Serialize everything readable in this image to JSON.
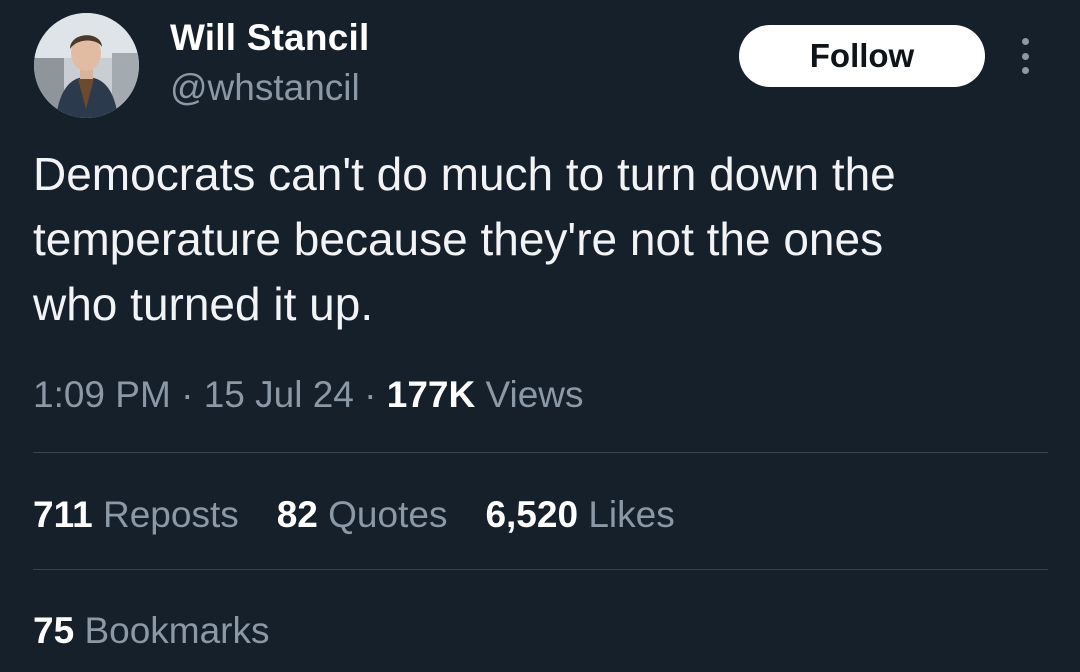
{
  "author": {
    "display_name": "Will Stancil",
    "handle": "@whstancil",
    "avatar_icon": "profile-photo"
  },
  "header": {
    "follow_label": "Follow",
    "more_icon": "more-vertical-icon"
  },
  "tweet": {
    "lines": [
      "Democrats can't do much to turn down the",
      "temperature because they're not the ones",
      "who turned it up."
    ]
  },
  "meta": {
    "time": "1:09 PM",
    "separator": "·",
    "date": "15 Jul 24",
    "views_count": "177K",
    "views_label": "Views"
  },
  "stats": {
    "reposts_count": "711",
    "reposts_label": "Reposts",
    "quotes_count": "82",
    "quotes_label": "Quotes",
    "likes_count": "6,520",
    "likes_label": "Likes",
    "bookmarks_count": "75",
    "bookmarks_label": "Bookmarks"
  },
  "colors": {
    "background": "#16202b",
    "primary_text": "#ffffff",
    "secondary_text": "#8b98a5",
    "divider": "#38444d",
    "follow_bg": "#ffffff"
  }
}
